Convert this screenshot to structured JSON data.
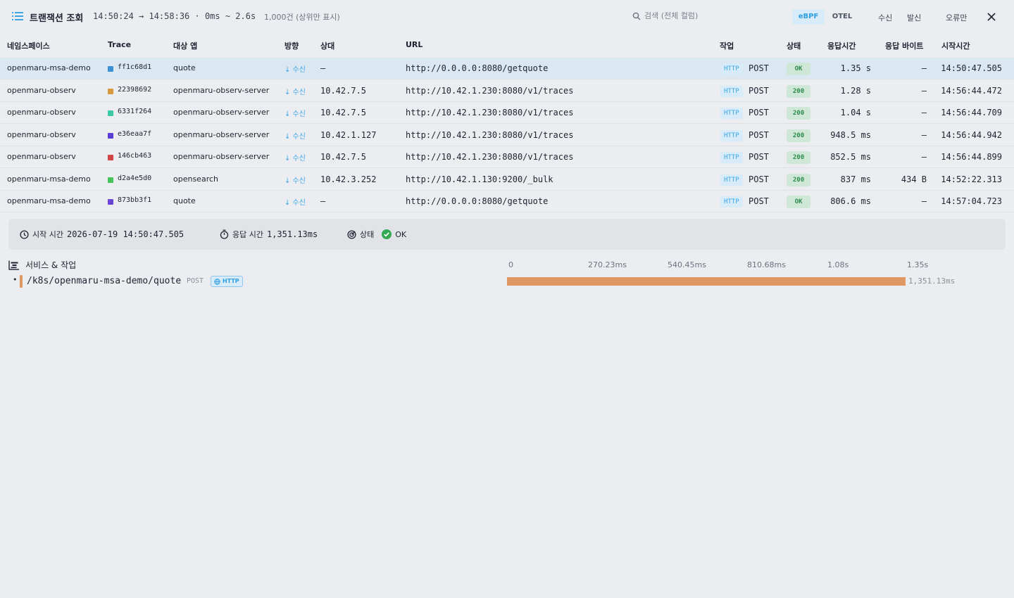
{
  "header": {
    "title": "트랜잭션 조회",
    "time_range": "14:50:24 → 14:58:36 · 0ms ~ 2.6s",
    "count": "1,000건 (상위만 표시)",
    "search_placeholder": "검색 (전체 컬럼)",
    "source_tabs": [
      "eBPF",
      "OTEL"
    ],
    "active_source": "eBPF",
    "filters": [
      "수신",
      "발신",
      "오류만"
    ]
  },
  "table": {
    "columns": [
      "네임스페이스",
      "Trace",
      "대상 앱",
      "방향",
      "상대",
      "URL",
      "작업",
      "상태",
      "응답시간",
      "응답 바이트",
      "시작시간"
    ],
    "rows": [
      {
        "namespace": "openmaru-msa-demo",
        "color": "#3d8fd6",
        "trace": "ff1c68d1",
        "app": "quote",
        "direction": "↓ 수신",
        "peer": "—",
        "url": "http://0.0.0.0:8080/getquote",
        "protocol": "HTTP",
        "method": "POST",
        "status": "OK",
        "duration": "1.35 s",
        "bytes": "—",
        "start": "14:50:47.505"
      },
      {
        "namespace": "openmaru-observ",
        "color": "#d69a3d",
        "trace": "22398692",
        "app": "openmaru-observ-server",
        "direction": "↓ 수신",
        "peer": "10.42.7.5",
        "url": "http://10.42.1.230:8080/v1/traces",
        "protocol": "HTTP",
        "method": "POST",
        "status": "200",
        "duration": "1.28 s",
        "bytes": "—",
        "start": "14:56:44.472"
      },
      {
        "namespace": "openmaru-observ",
        "color": "#3dc9a6",
        "trace": "6331f264",
        "app": "openmaru-observ-server",
        "direction": "↓ 수신",
        "peer": "10.42.7.5",
        "url": "http://10.42.1.230:8080/v1/traces",
        "protocol": "HTTP",
        "method": "POST",
        "status": "200",
        "duration": "1.04 s",
        "bytes": "—",
        "start": "14:56:44.709"
      },
      {
        "namespace": "openmaru-observ",
        "color": "#5a3dd6",
        "trace": "e36eaa7f",
        "app": "openmaru-observ-server",
        "direction": "↓ 수신",
        "peer": "10.42.1.127",
        "url": "http://10.42.1.230:8080/v1/traces",
        "protocol": "HTTP",
        "method": "POST",
        "status": "200",
        "duration": "948.5 ms",
        "bytes": "—",
        "start": "14:56:44.942"
      },
      {
        "namespace": "openmaru-observ",
        "color": "#d64545",
        "trace": "146cb463",
        "app": "openmaru-observ-server",
        "direction": "↓ 수신",
        "peer": "10.42.7.5",
        "url": "http://10.42.1.230:8080/v1/traces",
        "protocol": "HTTP",
        "method": "POST",
        "status": "200",
        "duration": "852.5 ms",
        "bytes": "—",
        "start": "14:56:44.899"
      },
      {
        "namespace": "openmaru-msa-demo",
        "color": "#45c45a",
        "trace": "d2a4e5d0",
        "app": "opensearch",
        "direction": "↓ 수신",
        "peer": "10.42.3.252",
        "url": "http://10.42.1.130:9200/_bulk",
        "protocol": "HTTP",
        "method": "POST",
        "status": "200",
        "duration": "837 ms",
        "bytes": "434 B",
        "start": "14:52:22.313"
      },
      {
        "namespace": "openmaru-msa-demo",
        "color": "#6a45d6",
        "trace": "873bb3f1",
        "app": "quote",
        "direction": "↓ 수신",
        "peer": "—",
        "url": "http://0.0.0.0:8080/getquote",
        "protocol": "HTTP",
        "method": "POST",
        "status": "OK",
        "duration": "806.6 ms",
        "bytes": "—",
        "start": "14:57:04.723"
      }
    ]
  },
  "summary": {
    "start_label": "시작 시간",
    "start_value": "2026-07-19 14:50:47.505",
    "duration_label": "응답 시간",
    "duration_value": "1,351.13ms",
    "status_label": "상태",
    "status_value": "OK"
  },
  "waterfall": {
    "heading": "서비스 & 작업",
    "ticks": [
      "0",
      "270.23ms",
      "540.45ms",
      "810.68ms",
      "1.08s",
      "1.35s"
    ],
    "spans": [
      {
        "name": "/k8s/openmaru-msa-demo/quote",
        "method": "POST",
        "protocol": "HTTP",
        "duration_ms": 1351.13,
        "duration_label": "1,351.13ms",
        "start_ms": 0,
        "color": "#df9864"
      }
    ],
    "total_ms": 1351.13
  }
}
